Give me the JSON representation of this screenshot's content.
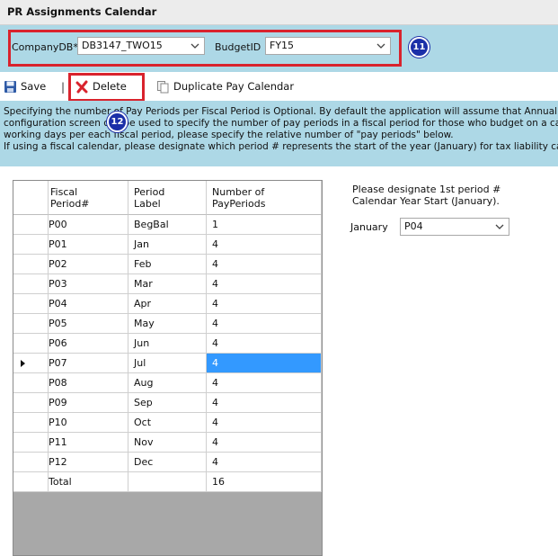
{
  "window": {
    "title": "PR Assignments Calendar"
  },
  "filters": {
    "company_label": "CompanyDB*",
    "company_value": "DB3147_TWO15",
    "budget_label": "BudgetID",
    "budget_value": "FY15",
    "callout": "11"
  },
  "toolbar": {
    "save_label": "Save",
    "separator": "|",
    "delete_label": "Delete",
    "duplicate_label": "Duplicate Pay Calendar",
    "callout": "12"
  },
  "info": {
    "line1": "Specifying the number of Pay Periods per Fiscal Period is Optional. By default the application will assume that Annual Salary will b",
    "line2": "configuration screen can be used to specify the number of pay periods in a fiscal period for those who budget on a cash basis, or",
    "line3": "working days per each fiscal period, please specify the relative number of \"pay periods\" below.",
    "line4": "If using a fiscal calendar, please designate which period # represents the start of the year (January) for tax liability calculations."
  },
  "grid": {
    "headers": [
      [
        "Fiscal",
        "Period#"
      ],
      [
        "Period",
        "Label"
      ],
      [
        "Number of",
        "PayPeriods"
      ]
    ],
    "rows": [
      {
        "period": "P00",
        "label": "BegBal",
        "count": "1"
      },
      {
        "period": "P01",
        "label": "Jan",
        "count": "4"
      },
      {
        "period": "P02",
        "label": "Feb",
        "count": "4"
      },
      {
        "period": "P03",
        "label": "Mar",
        "count": "4"
      },
      {
        "period": "P04",
        "label": "Apr",
        "count": "4"
      },
      {
        "period": "P05",
        "label": "May",
        "count": "4"
      },
      {
        "period": "P06",
        "label": "Jun",
        "count": "4"
      },
      {
        "period": "P07",
        "label": "Jul",
        "count": "4"
      },
      {
        "period": "P08",
        "label": "Aug",
        "count": "4"
      },
      {
        "period": "P09",
        "label": "Sep",
        "count": "4"
      },
      {
        "period": "P10",
        "label": "Oct",
        "count": "4"
      },
      {
        "period": "P11",
        "label": "Nov",
        "count": "4"
      },
      {
        "period": "P12",
        "label": "Dec",
        "count": "4"
      },
      {
        "period": "Total",
        "label": "",
        "count": "16"
      }
    ],
    "selected_row_index": 7
  },
  "side": {
    "prompt_line1": "Please designate 1st period #",
    "prompt_line2": "Calendar Year Start (January).",
    "january_label": "January",
    "january_value": "P04"
  },
  "colors": {
    "panel": "#add8e6",
    "highlight": "#d9232d",
    "callout": "#1b2fa8",
    "selection": "#3399ff"
  }
}
